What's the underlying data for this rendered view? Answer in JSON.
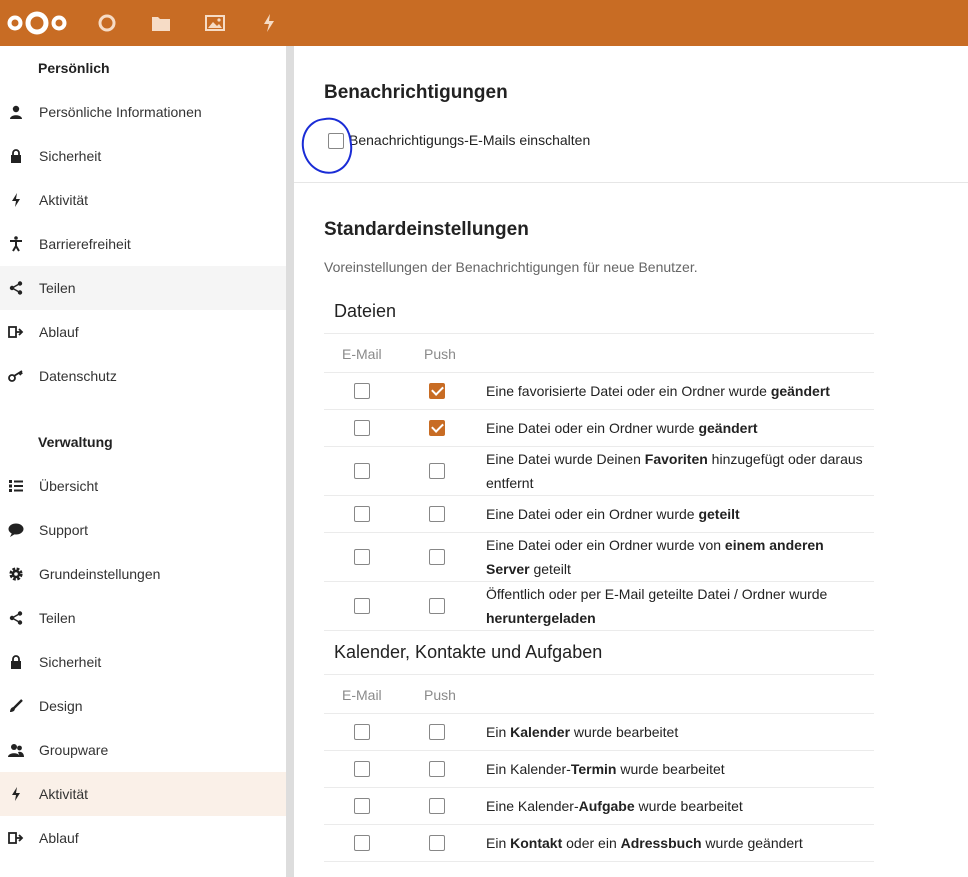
{
  "header": {
    "logo": "nextcloud-logo",
    "apps": [
      "dashboard-icon",
      "files-icon",
      "photos-icon",
      "activity-icon"
    ]
  },
  "sidebar": {
    "personal_heading": "Persönlich",
    "personal_items": [
      {
        "label": "Persönliche Informationen",
        "icon": "person-icon"
      },
      {
        "label": "Sicherheit",
        "icon": "lock-icon"
      },
      {
        "label": "Aktivität",
        "icon": "activity-icon"
      },
      {
        "label": "Barrierefreiheit",
        "icon": "accessibility-icon"
      },
      {
        "label": "Teilen",
        "icon": "share-icon"
      },
      {
        "label": "Ablauf",
        "icon": "flow-icon"
      },
      {
        "label": "Datenschutz",
        "icon": "key-icon"
      }
    ],
    "admin_heading": "Verwaltung",
    "admin_items": [
      {
        "label": "Übersicht",
        "icon": "list-icon"
      },
      {
        "label": "Support",
        "icon": "speech-bubble-icon"
      },
      {
        "label": "Grundeinstellungen",
        "icon": "gear-icon"
      },
      {
        "label": "Teilen",
        "icon": "share-icon"
      },
      {
        "label": "Sicherheit",
        "icon": "lock-icon"
      },
      {
        "label": "Design",
        "icon": "brush-icon"
      },
      {
        "label": "Groupware",
        "icon": "group-icon"
      },
      {
        "label": "Aktivität",
        "icon": "activity-icon"
      },
      {
        "label": "Ablauf",
        "icon": "flow-icon"
      }
    ]
  },
  "notifications": {
    "title": "Benachrichtigungen",
    "email_toggle_label": "Benachrichtigungs-E-Mails einschalten",
    "email_toggle_checked": false
  },
  "defaults": {
    "title": "Standardeinstellungen",
    "subtitle": "Voreinstellungen der Benachrichtigungen für neue Benutzer.",
    "col_email": "E-Mail",
    "col_push": "Push",
    "groups": [
      {
        "title": "Dateien",
        "rows": [
          {
            "parts": [
              "Eine favorisierte Datei oder ein Ordner wurde ",
              "**geändert"
            ],
            "email": false,
            "push": true
          },
          {
            "parts": [
              "Eine Datei oder ein Ordner wurde ",
              "**geändert"
            ],
            "email": false,
            "push": true
          },
          {
            "parts": [
              "Eine Datei wurde Deinen ",
              "**Favoriten",
              " hinzugefügt oder daraus entfernt"
            ],
            "email": false,
            "push": false
          },
          {
            "parts": [
              "Eine Datei oder ein Ordner wurde ",
              "**geteilt"
            ],
            "email": false,
            "push": false
          },
          {
            "parts": [
              "Eine Datei oder ein Ordner wurde von ",
              "**einem anderen Server",
              " geteilt"
            ],
            "email": false,
            "push": false
          },
          {
            "parts": [
              "Öffentlich oder per E-Mail geteilte Datei / Ordner wurde ",
              "**heruntergeladen"
            ],
            "email": false,
            "push": false
          }
        ]
      },
      {
        "title": "Kalender, Kontakte und Aufgaben",
        "rows": [
          {
            "parts": [
              "Ein ",
              "**Kalender",
              " wurde bearbeitet"
            ],
            "email": false,
            "push": false
          },
          {
            "parts": [
              "Ein Kalender-",
              "**Termin",
              " wurde bearbeitet"
            ],
            "email": false,
            "push": false
          },
          {
            "parts": [
              "Eine Kalender-",
              "**Aufgabe",
              " wurde bearbeitet"
            ],
            "email": false,
            "push": false
          },
          {
            "parts": [
              "Ein ",
              "**Kontakt",
              " oder ein ",
              "**Adressbuch",
              " wurde geändert"
            ],
            "email": false,
            "push": false
          }
        ]
      }
    ]
  }
}
